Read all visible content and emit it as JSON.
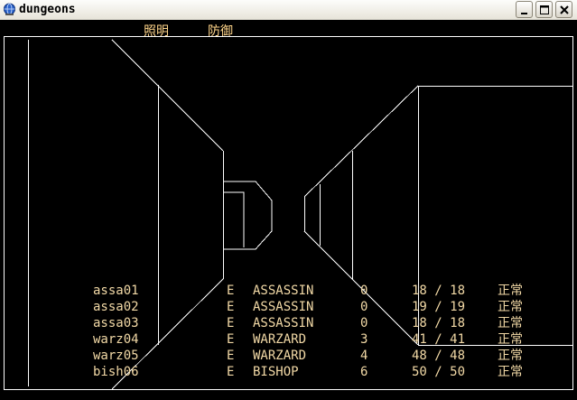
{
  "window": {
    "title": "dungeons"
  },
  "menu": {
    "items": [
      "照明",
      "防御"
    ]
  },
  "party": [
    {
      "name": "assa01",
      "alignment": "E",
      "class": "ASSASSIN",
      "ac": "0",
      "hp": "18 / 18",
      "status": "正常"
    },
    {
      "name": "assa02",
      "alignment": "E",
      "class": "ASSASSIN",
      "ac": "0",
      "hp": "19 / 19",
      "status": "正常"
    },
    {
      "name": "assa03",
      "alignment": "E",
      "class": "ASSASSIN",
      "ac": "0",
      "hp": "18 / 18",
      "status": "正常"
    },
    {
      "name": "warz04",
      "alignment": "E",
      "class": "WARZARD",
      "ac": "3",
      "hp": "41 / 41",
      "status": "正常"
    },
    {
      "name": "warz05",
      "alignment": "E",
      "class": "WARZARD",
      "ac": "4",
      "hp": "48 / 48",
      "status": "正常"
    },
    {
      "name": "bish06",
      "alignment": "E",
      "class": "BISHOP",
      "ac": "6",
      "hp": "50 / 50",
      "status": "正常"
    }
  ],
  "colors": {
    "menu_text": "#ffd58a",
    "party_text": "#f2d9a6",
    "wireframe": "#ffffff",
    "background": "#000000"
  },
  "icons": {
    "app": "globe-icon",
    "minimize": "minimize-icon",
    "maximize": "maximize-icon",
    "close": "close-icon"
  }
}
